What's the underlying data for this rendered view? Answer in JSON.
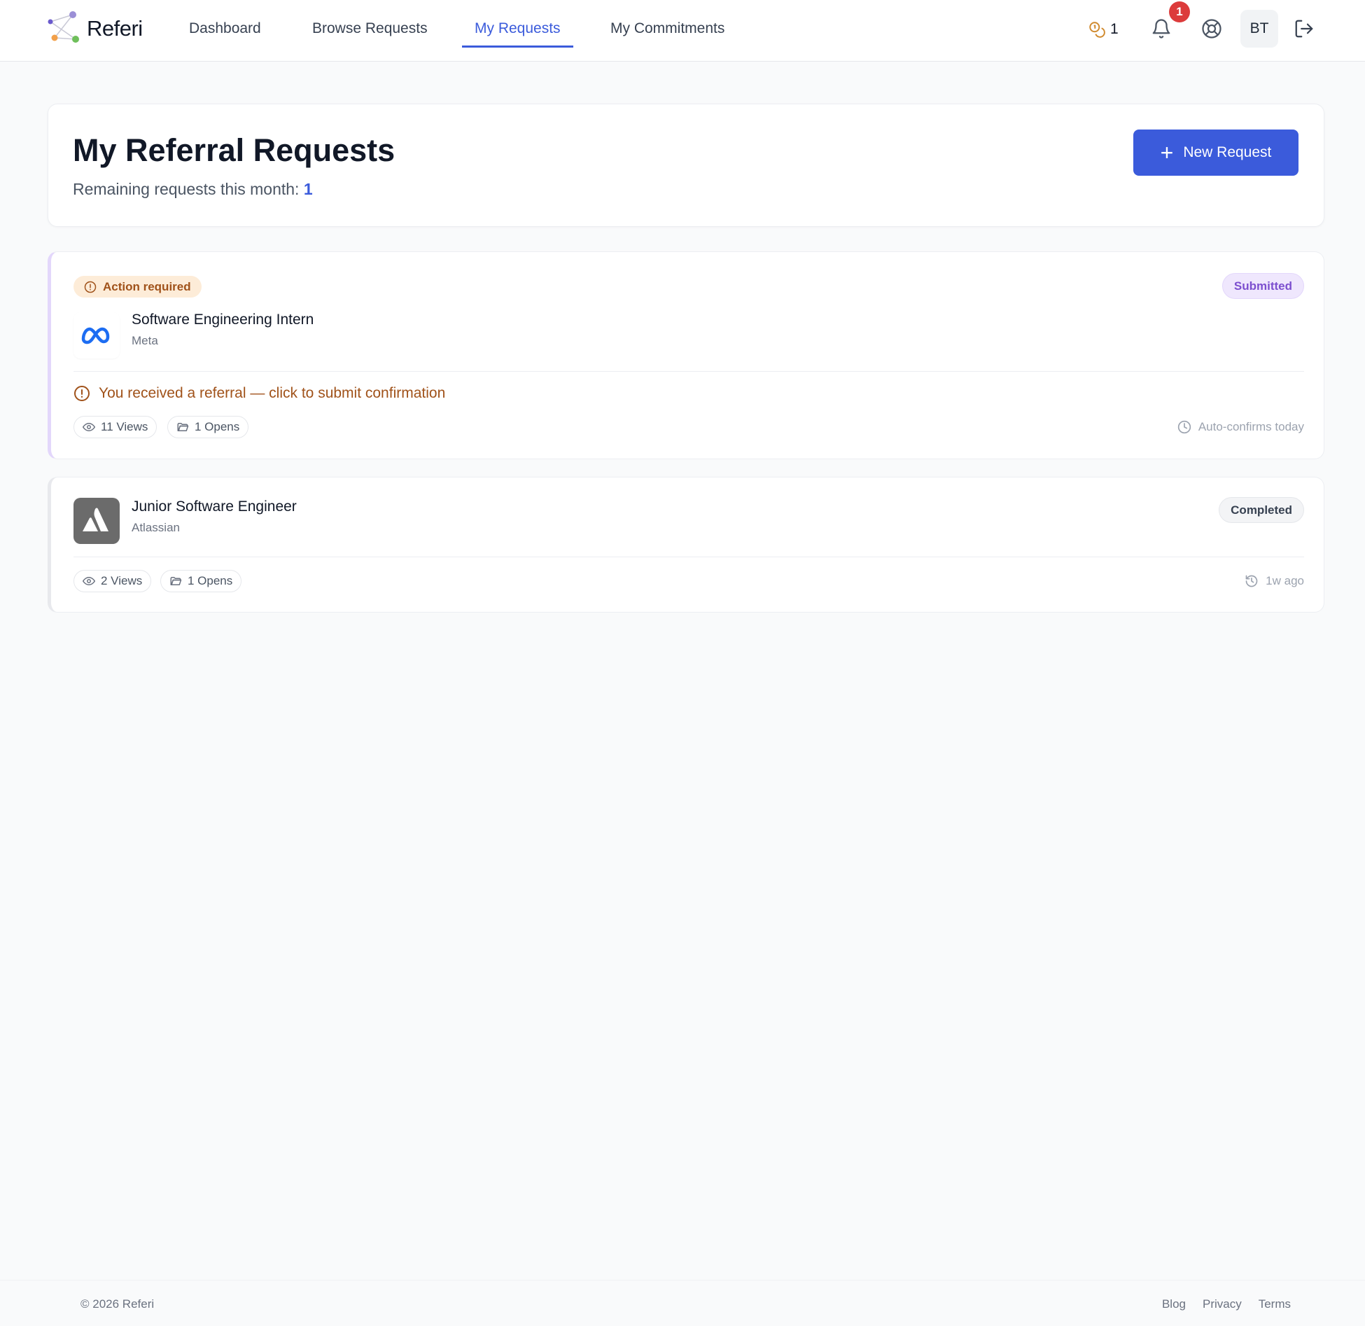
{
  "app": {
    "name": "Referi"
  },
  "nav": {
    "items": [
      {
        "label": "Dashboard"
      },
      {
        "label": "Browse Requests"
      },
      {
        "label": "My Requests",
        "active": true
      },
      {
        "label": "My Commitments"
      }
    ]
  },
  "header": {
    "credits": "1",
    "notifications_count": "1",
    "avatar_initials": "BT",
    "icons": [
      "coins-icon",
      "bell-icon",
      "help-lifebuoy-icon",
      "logout-icon"
    ]
  },
  "page": {
    "title": "My Referral Requests",
    "remaining_label": "Remaining requests this month:",
    "remaining_value": "1",
    "new_request_label": "New Request"
  },
  "requests": [
    {
      "action_badge": "Action required",
      "status": "Submitted",
      "job_title": "Software Engineering Intern",
      "company": "Meta",
      "alert": "You received a referral — click to submit confirmation",
      "views": "11 Views",
      "opens": "1 Opens",
      "meta": "Auto-confirms today"
    },
    {
      "status": "Completed",
      "job_title": "Junior Software Engineer",
      "company": "Atlassian",
      "views": "2 Views",
      "opens": "1 Opens",
      "meta": "1w ago"
    }
  ],
  "footer": {
    "copyright": "© 2026 Referi",
    "links": [
      "Blog",
      "Privacy",
      "Terms"
    ]
  },
  "colors": {
    "accent": "#3b5bdb",
    "warning": "#a0521a",
    "submitted": "#7c4fcf",
    "badge": "#dc3b3b"
  }
}
